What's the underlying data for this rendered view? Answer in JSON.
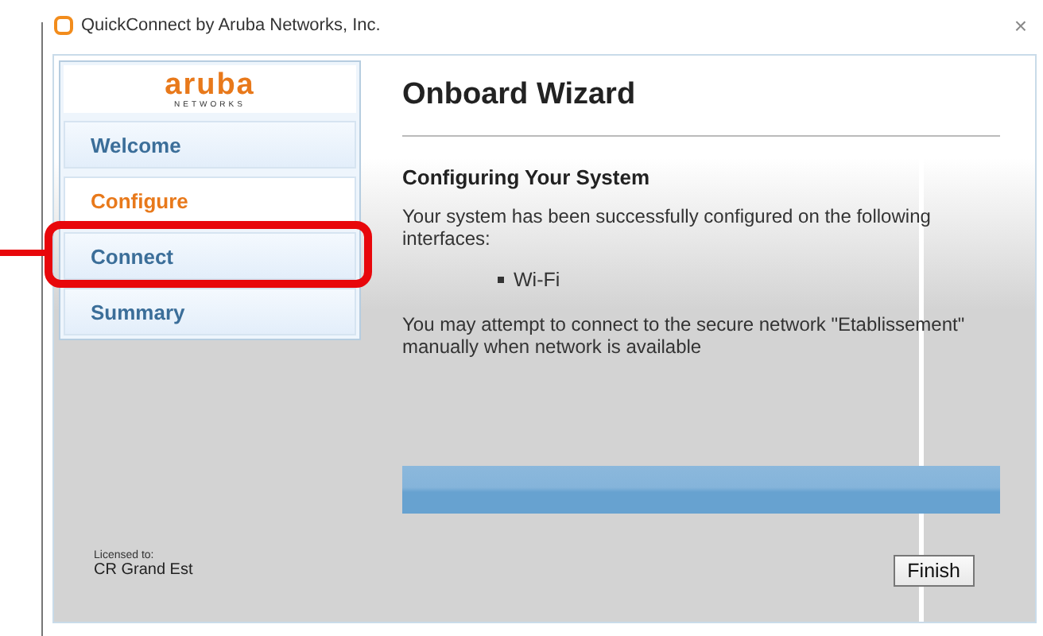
{
  "window": {
    "title": "QuickConnect by Aruba Networks, Inc.",
    "close": "×"
  },
  "logo": {
    "name": "aruba",
    "subtitle": "NETWORKS"
  },
  "nav": [
    {
      "label": "Welcome",
      "selected": false
    },
    {
      "label": "Configure",
      "selected": true
    },
    {
      "label": "Connect",
      "selected": false
    },
    {
      "label": "Summary",
      "selected": false
    }
  ],
  "license": {
    "label": "Licensed to:",
    "holder": "CR Grand Est"
  },
  "content": {
    "title": "Onboard Wizard",
    "heading": "Configuring Your System",
    "intro": "Your system has been successfully configured on the following interfaces:",
    "interfaces": [
      "Wi-Fi"
    ],
    "note": "You may attempt to connect to the secure network \"Etablissement\" manually when network is available"
  },
  "progress": {
    "level": 1
  },
  "buttons": [
    {
      "label": "Finish"
    }
  ]
}
